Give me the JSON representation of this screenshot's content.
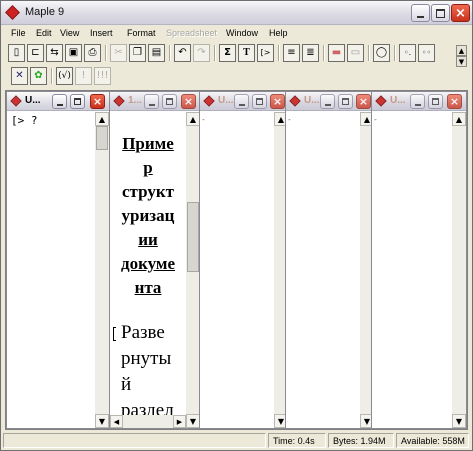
{
  "window": {
    "title": "Maple 9"
  },
  "menu": {
    "items": [
      {
        "label": "File",
        "enabled": true
      },
      {
        "label": "Edit",
        "enabled": true
      },
      {
        "label": "View",
        "enabled": true
      },
      {
        "label": "Insert",
        "enabled": true
      },
      {
        "label": "Format",
        "enabled": true
      },
      {
        "label": "Spreadsheet",
        "enabled": false
      },
      {
        "label": "Window",
        "enabled": true
      },
      {
        "label": "Help",
        "enabled": true
      }
    ]
  },
  "toolbar": {
    "sum_symbol": "Σ",
    "text_symbol": "T",
    "prompt_symbol": "[>"
  },
  "children": [
    {
      "title": "U...",
      "active": true,
      "prompt": "[> ?"
    },
    {
      "title": "1...",
      "active": false
    },
    {
      "title": "U...",
      "active": false
    },
    {
      "title": "U...",
      "active": false
    },
    {
      "title": "U...",
      "active": false
    }
  ],
  "document": {
    "heading_lines": [
      "Приме",
      "р",
      "структ",
      "уризац",
      "ии",
      "докуме",
      "нта"
    ],
    "body_lines": [
      "Разве",
      "рнуты",
      "й",
      "раздел"
    ]
  },
  "status": {
    "time": "Time:    0.4s",
    "bytes": "Bytes: 1.94M",
    "available": "Available: 558M"
  }
}
